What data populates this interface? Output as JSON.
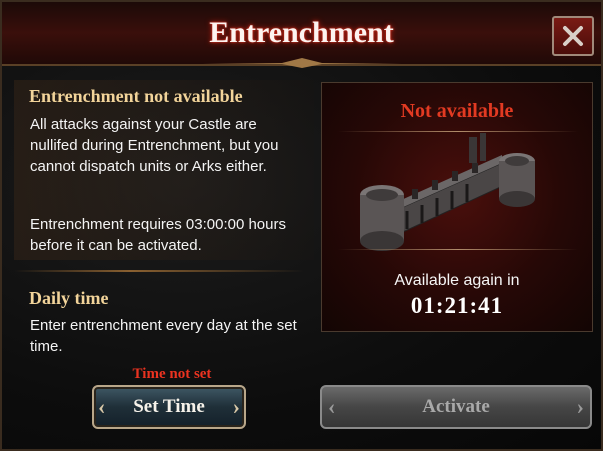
{
  "header": {
    "title": "Entrenchment"
  },
  "info": {
    "heading": "Entrenchment not available",
    "description": "All attacks against your Castle are nullifed during Entrenchment, but you cannot dispatch units or Arks either.",
    "requirement": "Entrenchment requires 03:00:00 hours before it can be activated."
  },
  "daily": {
    "heading": "Daily time",
    "description": "Enter entrenchment every day at the set time.",
    "status": "Time not set",
    "set_time_label": "Set Time"
  },
  "status_panel": {
    "status": "Not available",
    "available_again_label": "Available again in",
    "countdown": "01:21:41"
  },
  "actions": {
    "activate_label": "Activate"
  },
  "icons": {
    "close": "close-icon",
    "castle": "castle-wall-image"
  },
  "colors": {
    "title_glow": "#c02010",
    "section_title": "#f2d49a",
    "status_red": "#e23a22",
    "disabled_button": "#464646"
  }
}
